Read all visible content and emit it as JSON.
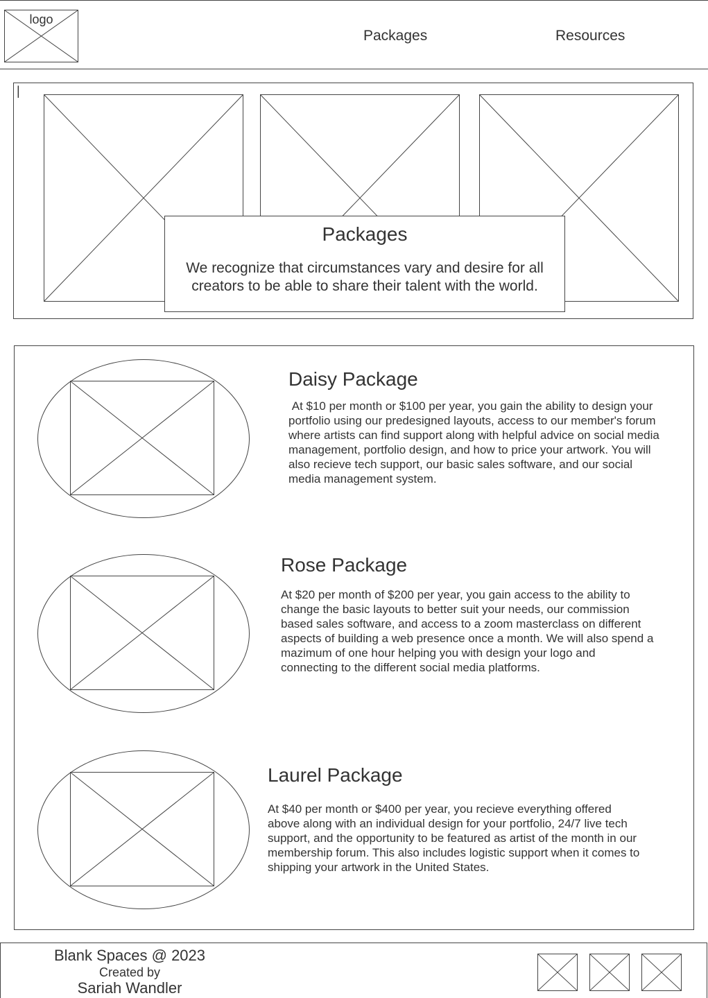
{
  "header": {
    "logo_label": "logo",
    "nav": [
      {
        "label": "Packages"
      },
      {
        "label": "Resources"
      }
    ]
  },
  "hero": {
    "cursor_mark": "|",
    "title": "Packages",
    "description": "We recognize that circumstances vary and desire for all creators to be able to share their talent with the world."
  },
  "packages": [
    {
      "title": "Daisy Package",
      "description": " At $10 per month or $100 per year, you gain the ability to design your portfolio using our predesigned layouts, access to our member's forum where artists can find support along with helpful advice on social media management, portfolio design, and how to price your artwork. You will also recieve tech support, our basic sales software, and our social media management system."
    },
    {
      "title": "Rose Package",
      "description": "At $20 per month of $200 per year, you gain access to the ability to change the basic layouts to better suit your needs, our commission based sales software, and access to a zoom masterclass on different aspects of building a web presence once a month. We will also spend a mazimum of one hour helping you with design your logo and connecting to the different social media platforms."
    },
    {
      "title": "Laurel Package",
      "description": "At $40 per month or $400 per year, you recieve everything offered above along with an individual design for your portfolio, 24/7 live tech support, and the opportunity to be featured as artist of the month in our membership forum. This also includes logistic support when it comes to shipping your artwork in the United States."
    }
  ],
  "footer": {
    "copyright": "Blank Spaces @ 2023",
    "created_by": "Created by",
    "author": "Sariah Wandler"
  }
}
